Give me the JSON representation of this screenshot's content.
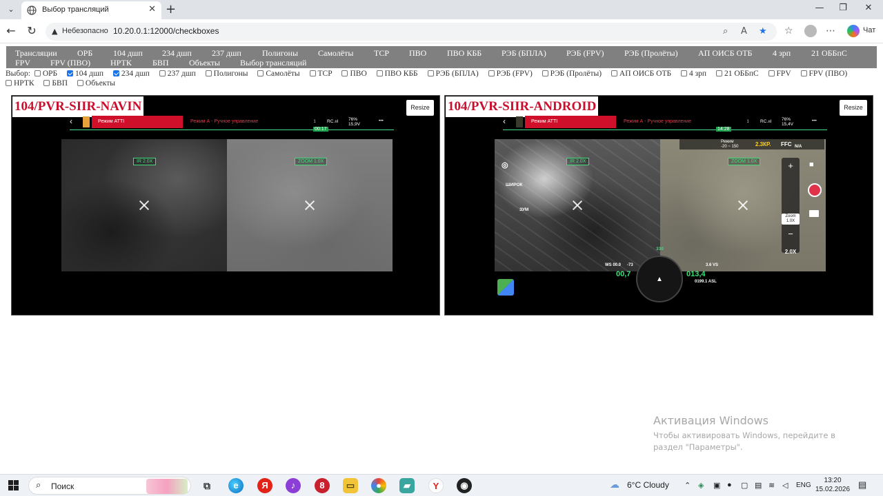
{
  "browser": {
    "tab_title": "Выбор трансляций",
    "insecure_label": "Небезопасно",
    "url": "10.20.0.1:12000/checkboxes",
    "chat_label": "Чат"
  },
  "nav": {
    "items": [
      "Трансляции",
      "ОРБ",
      "104 дшп",
      "234 дшп",
      "237 дшп",
      "Полигоны",
      "Самолёты",
      "ТСР",
      "ПВО",
      "ПВО КББ",
      "РЭБ (БПЛА)",
      "РЭБ (FPV)",
      "РЭБ (Пролёты)",
      "АП ОИСБ ОТБ",
      "4 зрп",
      "21 ОББпС",
      "FPV",
      "FPV (ПВО)",
      "НРТК",
      "БВП",
      "Объекты",
      "Выбор трансляций"
    ]
  },
  "filters": {
    "label": "Выбор:",
    "options": [
      {
        "label": "ОРБ",
        "checked": false
      },
      {
        "label": "104 дшп",
        "checked": true
      },
      {
        "label": "234 дшп",
        "checked": true
      },
      {
        "label": "237 дшп",
        "checked": false
      },
      {
        "label": "Полигоны",
        "checked": false
      },
      {
        "label": "Самолёты",
        "checked": false
      },
      {
        "label": "ТСР",
        "checked": false
      },
      {
        "label": "ПВО",
        "checked": false
      },
      {
        "label": "ПВО КББ",
        "checked": false
      },
      {
        "label": "РЭБ (БПЛА)",
        "checked": false
      },
      {
        "label": "РЭБ (FPV)",
        "checked": false
      },
      {
        "label": "РЭБ (Пролёты)",
        "checked": false
      },
      {
        "label": "АП ОИСБ ОТБ",
        "checked": false
      },
      {
        "label": "4 зрп",
        "checked": false
      },
      {
        "label": "21 ОББпС",
        "checked": false
      },
      {
        "label": "FPV",
        "checked": false
      },
      {
        "label": "FPV (ПВО)",
        "checked": false
      },
      {
        "label": "НРТК",
        "checked": false
      },
      {
        "label": "БВП",
        "checked": false
      },
      {
        "label": "Объекты",
        "checked": false
      }
    ]
  },
  "streams": [
    {
      "title": "104/PVR-SIIR-NAVIN",
      "resize_label": "Resize",
      "osd": {
        "mode_red": "Режим ATTI",
        "mode_text": "Режим А - Ручное управление",
        "rc": "RC.ııl",
        "battery": "76%\n15,9V",
        "time": "00:17",
        "dots": "•••"
      },
      "ir_tag": "IR 2.0X",
      "zoom_tag": "ZOOM 1.0X"
    },
    {
      "title": "104/PVR-SIIR-ANDROID",
      "resize_label": "Resize",
      "osd": {
        "mode_red": "Режим ATTI",
        "mode_text": "Режим А - Ручное управление",
        "rc": "RC.ııl",
        "battery": "76%\n15,4V",
        "time": "14:28",
        "dots": "•••"
      },
      "ir_tag": "IR 2.0X",
      "zoom_tag": "ZOOM 1.0X",
      "hud": {
        "mode": "Режим",
        "range": "-20 ~ 150",
        "kp": "2.3КР.",
        "ffc": "FFC",
        "na": "N/A",
        "wide": "ШИРОК",
        "zoom_lbl": "ЗУМ",
        "zoom_panel": "Zoom\n1.0X",
        "zoom_factor": "2.0X",
        "ws": "WS 00.0",
        "heading": "-73",
        "speed": "00,7",
        "alt": "013,4",
        "vs": "3.6 VS",
        "asl": "0199.1 ASL",
        "compass_deg": "330"
      }
    }
  ],
  "watermark": {
    "title": "Активация Windows",
    "body": "Чтобы активировать Windows, перейдите в раздел \"Параметры\"."
  },
  "taskbar": {
    "search_placeholder": "Поиск",
    "weather": "6°C  Cloudy",
    "lang": "ENG",
    "time": "13:20",
    "date": "15.02.2026"
  },
  "colors": {
    "nav_bg": "#808080",
    "stream_title": "#c8102e",
    "osd_red": "#d0102a",
    "hud_green": "#3ee07c",
    "hud_yellow": "#ffd21f"
  }
}
